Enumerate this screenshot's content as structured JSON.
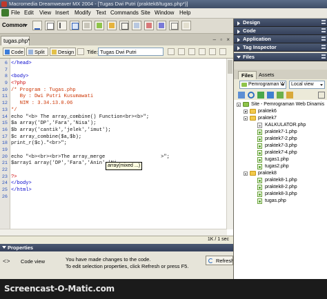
{
  "window": {
    "title": "Macromedia Dreamweaver MX 2004 - [Tugas Dwi Putri (praktek8/tugas.php*)]"
  },
  "menu": [
    "File",
    "Edit",
    "View",
    "Insert",
    "Modify",
    "Text",
    "Commands",
    "Site",
    "Window",
    "Help"
  ],
  "insert_bar": {
    "category": "Common"
  },
  "document": {
    "tab": "tugas.php*",
    "views": {
      "code": "Code",
      "split": "Split",
      "design": "Design"
    },
    "title_label": "Title:",
    "title_value": "Tugas Dwi Putri",
    "window_controls": "– ▫ ×"
  },
  "code": {
    "lines": [
      {
        "n": "6",
        "t": "</head>"
      },
      {
        "n": "7",
        "t": ""
      },
      {
        "n": "8",
        "t": "<body>"
      },
      {
        "n": "9",
        "t": "<?php"
      },
      {
        "n": "10",
        "t": "/* Program : Tugas.php"
      },
      {
        "n": "11",
        "t": "   By : Dwi Putri Kusumawati"
      },
      {
        "n": "12",
        "t": "   NIM : 3.34.13.0.06"
      },
      {
        "n": "13",
        "t": "*/"
      },
      {
        "n": "14",
        "t": "echo \"<b> The array_combine() Function<br><b>\";"
      },
      {
        "n": "15",
        "t": "$a array('DP','Fara','Nisa');"
      },
      {
        "n": "16",
        "t": "$b array('cantik','jelek','imut');"
      },
      {
        "n": "17",
        "t": "$c array_combine($a,$b);"
      },
      {
        "n": "18",
        "t": "print_r($c).\"<br>\";"
      },
      {
        "n": "19",
        "t": ""
      },
      {
        "n": "20",
        "t": "echo \"<b><br><br>The array_merge                   >\";"
      },
      {
        "n": "21",
        "t": "$array1 array('DP','Fara','Anin','Ni"
      },
      {
        "n": "22",
        "t": ""
      },
      {
        "n": "23",
        "t": "?>"
      },
      {
        "n": "24",
        "t": "</body>"
      },
      {
        "n": "25",
        "t": "</html>"
      },
      {
        "n": "26",
        "t": ""
      }
    ],
    "tooltip": "array(mixed ...)"
  },
  "status": {
    "size": "1K / 1 sec"
  },
  "properties": {
    "header": "Properties",
    "view": "Code view",
    "msg1": "You have made changes to the code.",
    "msg2": "To edit selection properties, click Refresh or press F5.",
    "refresh": "Refresh"
  },
  "panels": {
    "design": "Design",
    "code": "Code",
    "application": "Application",
    "tag_inspector": "Tag Inspector",
    "files": "Files"
  },
  "files": {
    "tabs": [
      "Files",
      "Assets"
    ],
    "site_select": "Pemrograman W",
    "view_select": "Local view",
    "tree": {
      "site": "Site - Pemrograman Web Dinamis",
      "f1": "praktek6",
      "f2": "praktek7",
      "f2_items": [
        "KALKULATOR.php",
        "praktek7-1.php",
        "praktek7-2.php",
        "praktek7-3.php",
        "praktek7-4.php",
        "tugas1.php",
        "tugas2.php"
      ],
      "f3": "praktek8",
      "f3_items": [
        "praktek8-1.php",
        "praktek8-2.php",
        "praktek8-3.php",
        "tugas.php"
      ]
    }
  },
  "watermark": "Screencast-O-Matic.com"
}
